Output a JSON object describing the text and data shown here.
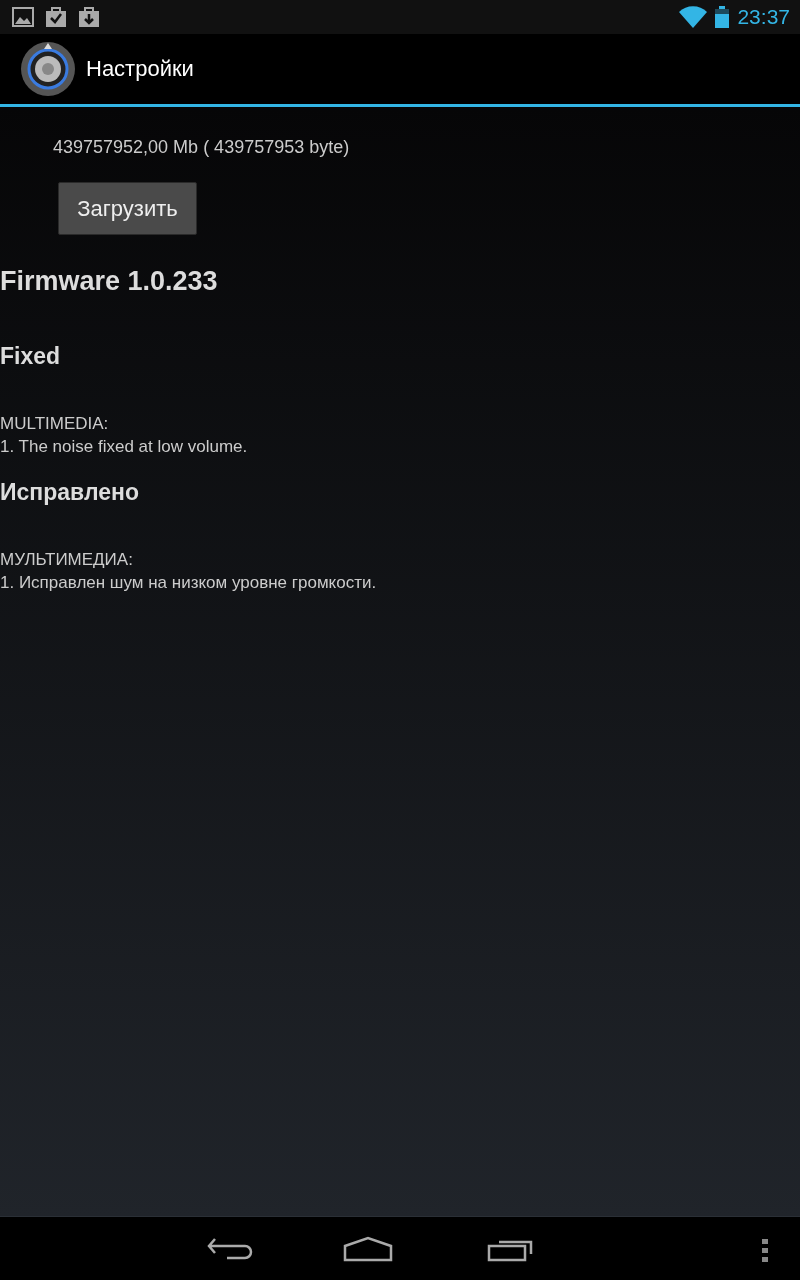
{
  "status_bar": {
    "time": "23:37"
  },
  "action_bar": {
    "title": "Настройки"
  },
  "file_size": "439757952,00 Mb ( 439757953 byte)",
  "download_button": "Загрузить",
  "firmware_title": "Firmware 1.0.233",
  "sections": [
    {
      "heading": "Fixed",
      "category": "MULTIMEDIA:",
      "items": [
        "1. The noise fixed at low volume."
      ]
    },
    {
      "heading": "Исправлено",
      "category": "МУЛЬТИМЕДИА:",
      "items": [
        "1. Исправлен шум на низком уровне громкости."
      ]
    }
  ]
}
